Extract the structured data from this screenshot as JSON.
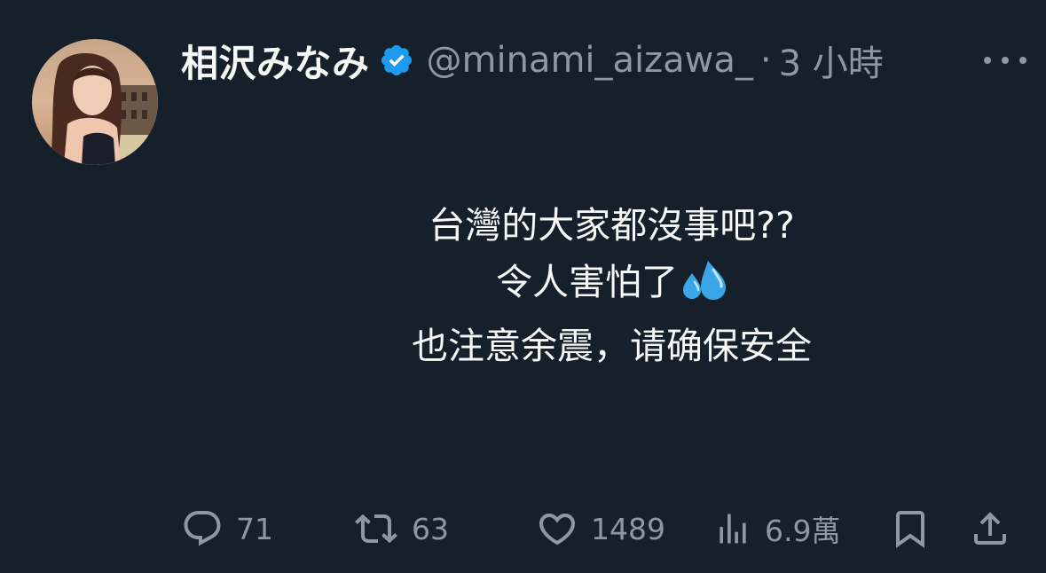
{
  "author": {
    "display_name": "相沢みなみ",
    "handle": "@minami_aizawa_",
    "separator": "·",
    "time": "3 小時",
    "verified": true,
    "verified_color": "#1d9bf0"
  },
  "tweet": {
    "lines": [
      "台灣的大家都沒事吧??",
      "令人害怕了",
      "也注意余震，请确保安全"
    ],
    "emoji": "sweat-droplets-icon"
  },
  "actions": {
    "reply_count": "71",
    "retweet_count": "63",
    "like_count": "1489",
    "views_count": "6.9萬"
  },
  "colors": {
    "background": "#15202b",
    "text": "#f7f9f9",
    "muted": "#8b98a5"
  }
}
